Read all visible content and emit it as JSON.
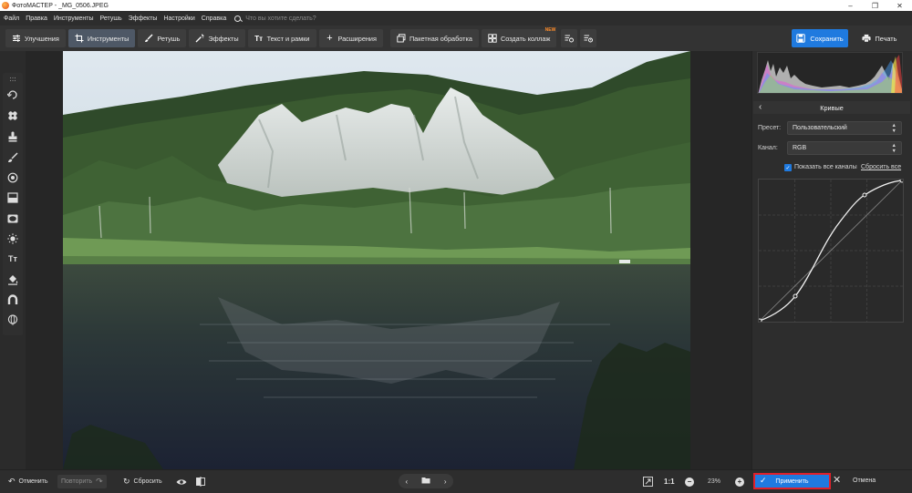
{
  "window": {
    "title": "ФотоМАСТЕР - _MG_0506.JPEG",
    "controls": [
      "minimize-icon",
      "maximize-icon",
      "close-icon"
    ]
  },
  "menu": {
    "items": [
      "Файл",
      "Правка",
      "Инструменты",
      "Ретушь",
      "Эффекты",
      "Настройки",
      "Справка"
    ],
    "search_placeholder": "Что вы хотите сделать?"
  },
  "toolbar": {
    "tabs": [
      {
        "label": "Улучшения",
        "icon": "sliders-icon"
      },
      {
        "label": "Инструменты",
        "icon": "crop-icon",
        "active": true
      },
      {
        "label": "Ретушь",
        "icon": "brush-icon"
      },
      {
        "label": "Эффекты",
        "icon": "magic-wand-icon"
      },
      {
        "label": "Текст и рамки",
        "icon": "text-icon"
      },
      {
        "label": "Расширения",
        "icon": "plus-icon"
      }
    ],
    "batch_label": "Пакетная обработка",
    "collage_label": "Создать коллаж",
    "collage_badge": "NEW",
    "save_label": "Сохранить",
    "print_label": "Печать"
  },
  "left_tools": [
    "rotate-icon",
    "heal-icon",
    "stamp-icon",
    "brush-icon",
    "radial-icon",
    "gradient-icon",
    "vignette-icon",
    "light-icon",
    "text-tool-icon",
    "fill-icon",
    "magnet-icon",
    "globe-icon"
  ],
  "panel": {
    "title": "Кривые",
    "preset_label": "Пресет:",
    "preset_value": "Пользовательский",
    "channel_label": "Канал:",
    "channel_value": "RGB",
    "show_all_label": "Показать все каналы",
    "show_all_checked": true,
    "reset_all_label": "Сбросить все"
  },
  "bottom": {
    "undo_label": "Отменить",
    "redo_label": "Повторить",
    "reset_label": "Сбросить",
    "ratio_label": "1:1",
    "zoom_value": "23%",
    "apply_label": "Применить",
    "cancel_label": "Отмена"
  },
  "colors": {
    "accent": "#1f7adf",
    "highlight_border": "#e0202a",
    "new_badge": "#ff8c2a"
  }
}
